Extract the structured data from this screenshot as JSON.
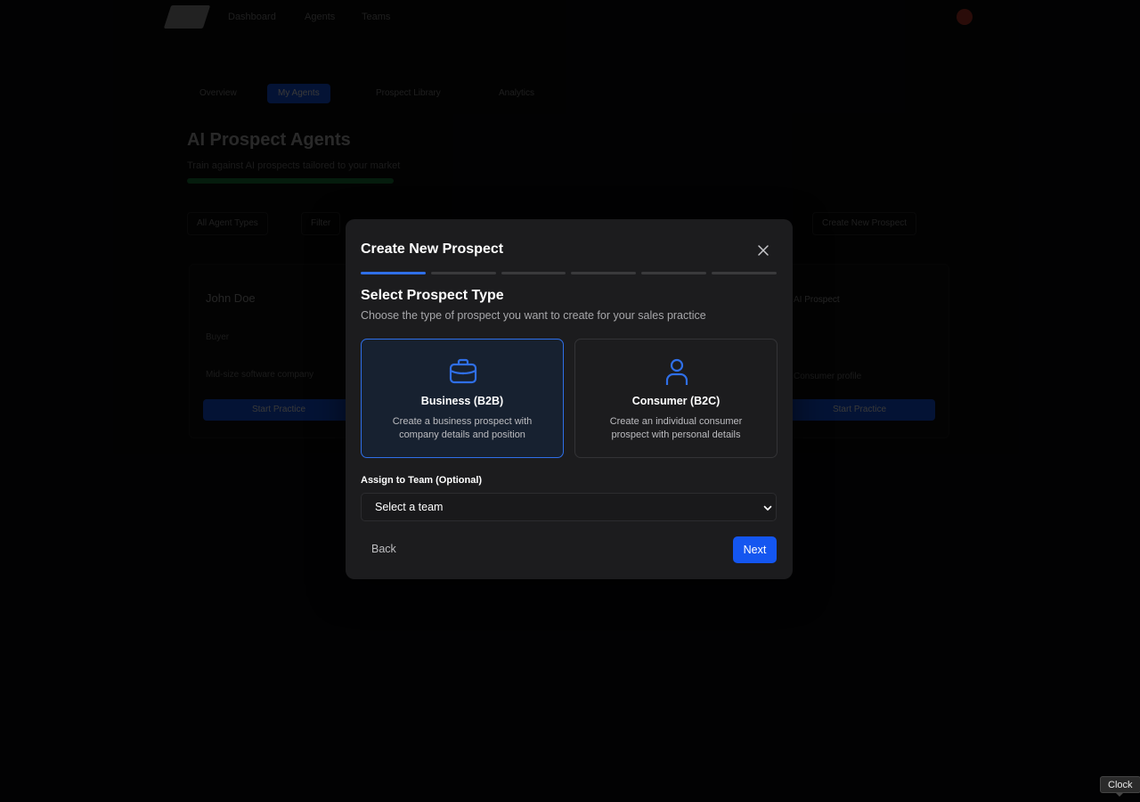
{
  "background": {
    "nav": [
      "Dashboard",
      "Agents",
      "Teams"
    ],
    "tabs": [
      "Overview",
      "My Agents",
      "Prospect Library",
      "Analytics"
    ],
    "title": "AI Prospect Agents",
    "subtitle": "Train against AI prospects tailored to your market",
    "buttons": [
      "All Agent Types",
      "Filter",
      "Create New Prospect"
    ],
    "card_left": {
      "name": "John Doe",
      "role": "Buyer",
      "meta": "Mid-size software company",
      "cta": "Start Practice"
    },
    "card_right": {
      "name": "AI Prospect",
      "meta": "Consumer profile",
      "cta": "Start Practice"
    }
  },
  "modal": {
    "title": "Create New Prospect",
    "steps": {
      "total": 6,
      "current": 1
    },
    "section_title": "Select Prospect Type",
    "section_desc": "Choose the type of prospect you want to create for your sales practice",
    "options": [
      {
        "icon": "briefcase-icon",
        "title": "Business (B2B)",
        "desc": "Create a business prospect with company details and position",
        "selected": true
      },
      {
        "icon": "user-icon",
        "title": "Consumer (B2C)",
        "desc": "Create an individual consumer prospect with personal details",
        "selected": false
      }
    ],
    "team_label": "Assign to Team (Optional)",
    "team_select": {
      "value": "Select a team"
    },
    "back_label": "Back",
    "next_label": "Next"
  },
  "tooltip": {
    "text": "Clock"
  },
  "colors": {
    "accent": "#2f6fe8",
    "primary_button": "#1456f0",
    "modal_bg": "#1c1c1e",
    "selected_card_bg": "#172130"
  }
}
